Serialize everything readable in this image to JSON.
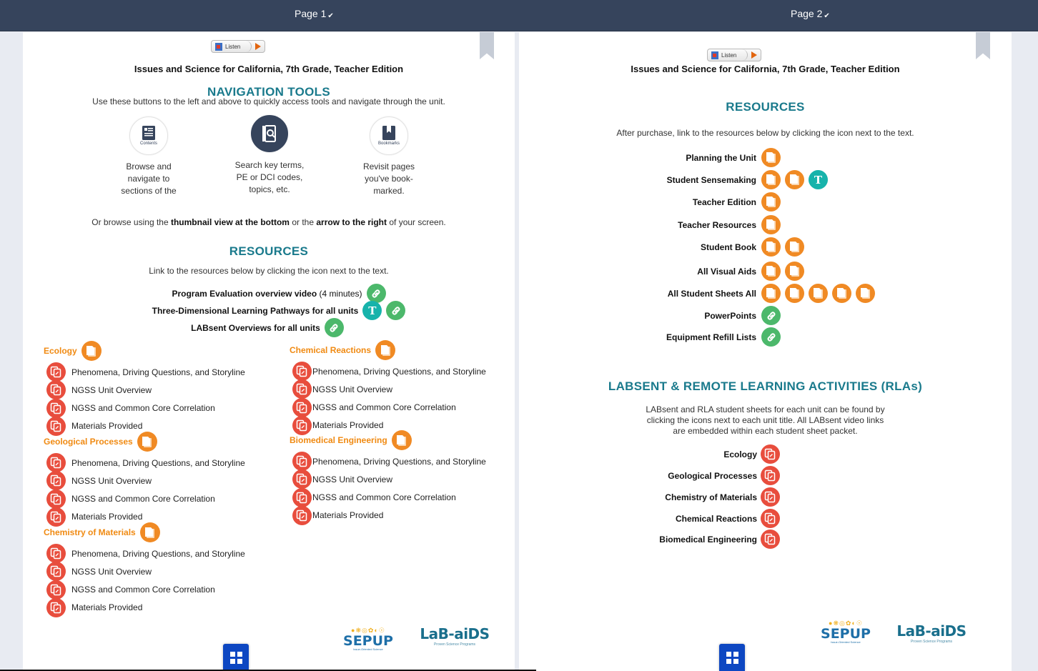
{
  "topbar": {
    "pages": [
      {
        "label": "Page 1",
        "chevron": "chevron-down-icon"
      },
      {
        "label": "Page 2",
        "chevron": "chevron-down-icon"
      }
    ]
  },
  "listen": {
    "label": "Listen"
  },
  "doc_title": "Issues and Science for California, 7th Grade, Teacher Edition",
  "page1": {
    "nav_heading": "NAVIGATION TOOLS",
    "nav_intro": "Use these buttons to the left and above to quickly access tools and navigate through the unit.",
    "nav_tools": [
      {
        "icon": "contents-icon",
        "caption": "Contents",
        "desc": [
          "Browse and",
          "navigate to",
          "sections of the"
        ]
      },
      {
        "icon": "search-icon",
        "caption": "",
        "desc": [
          "Search key terms,",
          "PE or DCI codes,",
          "topics, etc."
        ]
      },
      {
        "icon": "bookmark-icon",
        "caption": "Bookmarks",
        "desc": [
          "Revisit pages",
          "you've book-",
          "marked."
        ]
      }
    ],
    "browse_text": {
      "part1": "Or browse using the ",
      "bold1": "thumbnail view at the bottom",
      "part2": " or the ",
      "bold2": "arrow to the right",
      "part3": " of your screen."
    },
    "resources_heading": "RESOURCES",
    "resources_intro": "Link to the resources below by clicking the icon next to the text.",
    "resource_links": [
      {
        "label": "Program Evaluation overview video",
        "suffix": " (4 minutes)",
        "icons": [
          "link"
        ]
      },
      {
        "label": "Three-Dimensional Learning Pathways for all units",
        "suffix": "",
        "icons": [
          "teacher",
          "link"
        ]
      },
      {
        "label": "LABsent Overviews for all units",
        "suffix": "",
        "icons": [
          "link"
        ]
      }
    ],
    "units": [
      {
        "title": "Ecology",
        "items": [
          "Phenomena, Driving Questions, and Storyline",
          "NGSS Unit Overview",
          "NGSS and Common Core Correlation",
          "Materials Provided"
        ]
      },
      {
        "title": "Geological Processes",
        "items": [
          "Phenomena, Driving Questions, and Storyline",
          "NGSS Unit Overview",
          "NGSS and Common Core Correlation",
          "Materials Provided"
        ]
      },
      {
        "title": "Chemistry of Materials",
        "items": [
          "Phenomena, Driving Questions, and Storyline",
          "NGSS Unit Overview",
          "NGSS and Common Core Correlation",
          "Materials Provided"
        ]
      },
      {
        "title": "Chemical Reactions",
        "items": [
          "Phenomena, Driving Questions, and Storyline",
          "NGSS Unit Overview",
          "NGSS and Common Core Correlation",
          "Materials Provided"
        ]
      },
      {
        "title": "Biomedical Engineering",
        "items": [
          "Phenomena, Driving Questions, and Storyline",
          "NGSS Unit Overview",
          "NGSS and Common Core Correlation",
          "Materials Provided"
        ]
      }
    ]
  },
  "page2": {
    "resources_heading": "RESOURCES",
    "resources_intro": "After purchase, link to the resources below by clicking the icon next to the text.",
    "resources": [
      {
        "label": "Planning the Unit",
        "icons": [
          "doc"
        ]
      },
      {
        "label": "Student Sensemaking",
        "icons": [
          "doc",
          "doc",
          "teacher"
        ]
      },
      {
        "label": "Teacher Edition",
        "icons": [
          "doc"
        ]
      },
      {
        "label": "Teacher Resources",
        "icons": [
          "doc"
        ]
      },
      {
        "label": "Student Book",
        "icons": [
          "doc",
          "doc"
        ]
      },
      {
        "label": "All Visual Aids",
        "icons": [
          "doc",
          "doc"
        ]
      },
      {
        "label": "All Student Sheets All",
        "icons": [
          "doc",
          "doc",
          "doc",
          "doc",
          "doc"
        ]
      },
      {
        "label": "PowerPoints",
        "icons": [
          "link"
        ]
      },
      {
        "label": "Equipment Refill Lists",
        "icons": [
          "link"
        ]
      }
    ],
    "labsent_heading": "LABSENT & REMOTE LEARNING ACTIVITIES (RLAs)",
    "labsent_intro": [
      "LABsent and RLA student sheets for each unit can be found by",
      "clicking the icons next to each unit title. All LABsent video links",
      "are embedded within each student sheet packet."
    ],
    "labsent_units": [
      "Ecology",
      "Geological Processes",
      "Chemistry of Materials",
      "Chemical Reactions",
      "Biomedical Engineering"
    ]
  },
  "logos": {
    "sepup": {
      "word": "SEPUP",
      "tagline": "Issue-Oriented Science"
    },
    "labaids": {
      "word": "LaB-aiDS",
      "tagline": "Proven Science Programs"
    }
  },
  "teacher_icon_letter": "T",
  "colors": {
    "topbar": "#36445c",
    "heading_teal": "#1a7a8c",
    "unit_orange": "#f08a12",
    "icon_orange": "#f08a24",
    "icon_red": "#e84d3d",
    "icon_green": "#4cb86b",
    "icon_teal": "#17b3ab",
    "thumbnail_button": "#0d47c2"
  }
}
